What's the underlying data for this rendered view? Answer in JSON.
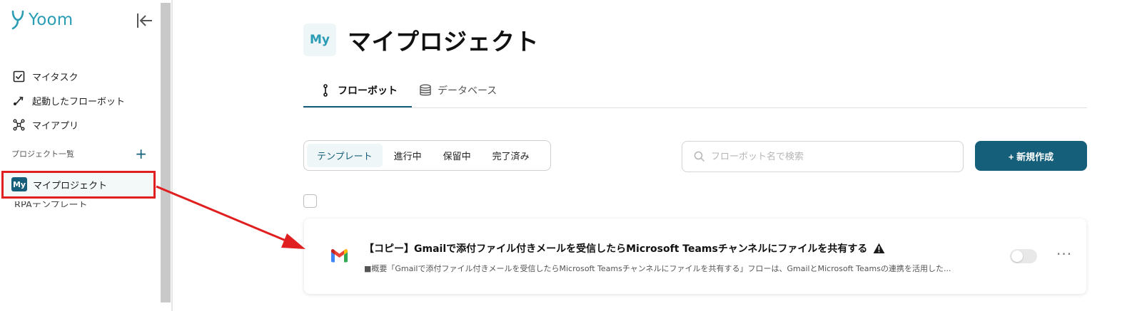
{
  "app": {
    "name": "Yoom",
    "brand_color": "#2a9db5",
    "accent_color": "#155f7a",
    "highlight_color": "#e02020"
  },
  "sidebar": {
    "collapse_icon": "collapse-left-icon",
    "nav": [
      {
        "label": "マイタスク",
        "icon": "task-check-icon"
      },
      {
        "label": "起動したフローボット",
        "icon": "flow-started-icon"
      },
      {
        "label": "マイアプリ",
        "icon": "apps-network-icon"
      }
    ],
    "section_label": "プロジェクト一覧",
    "add_label": "+",
    "project": {
      "badge": "My",
      "label": "マイプロジェクト"
    },
    "clipped_item": "RPAテンプレート"
  },
  "main": {
    "title_badge": "My",
    "title": "マイプロジェクト",
    "tabs": [
      {
        "label": "フローボット",
        "icon": "flowbot-icon",
        "active": true
      },
      {
        "label": "データベース",
        "icon": "database-icon",
        "active": false
      }
    ],
    "filters": [
      {
        "label": "テンプレート",
        "active": true
      },
      {
        "label": "進行中",
        "active": false
      },
      {
        "label": "保留中",
        "active": false
      },
      {
        "label": "完了済み",
        "active": false
      }
    ],
    "search": {
      "placeholder": "フローボット名で検索",
      "value": ""
    },
    "new_button": "+ 新規作成",
    "card": {
      "title": "【コピー】Gmailで添付ファイル付きメールを受信したらMicrosoft Teamsチャンネルにファイルを共有する",
      "description": "■概要「Gmailで添付ファイル付きメールを受信したらMicrosoft Teamsチャンネルにファイルを共有する」フローは、GmailとMicrosoft Teamsの連携を活用した...",
      "app_icon": "gmail-icon",
      "warning_icon": "warning-icon",
      "enabled": false,
      "more_label": "···"
    }
  }
}
